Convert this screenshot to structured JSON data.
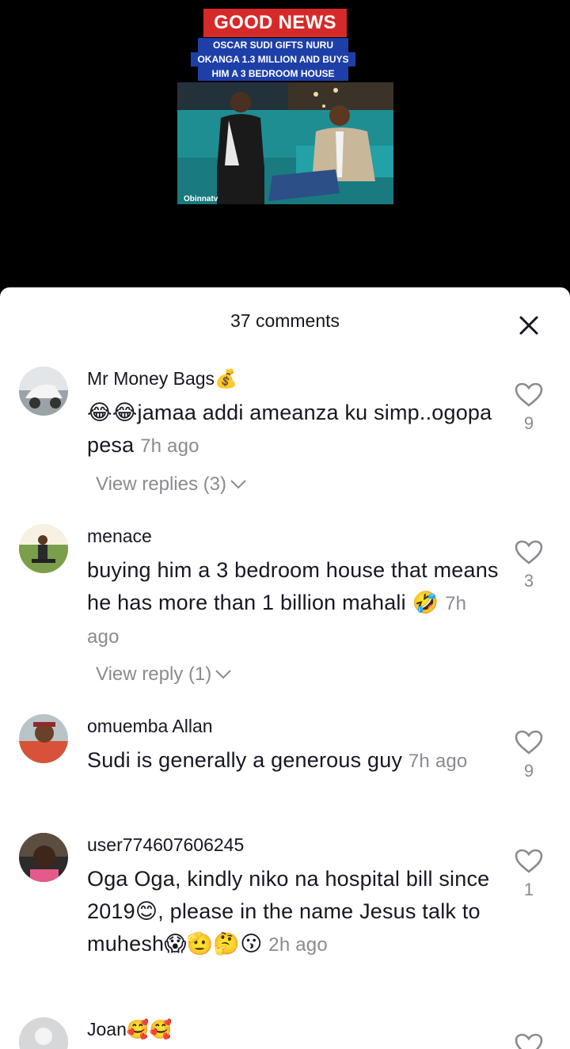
{
  "video": {
    "headline": "GOOD NEWS",
    "sub_lines": [
      "OSCAR SUDI GIFTS NURU",
      "OKANGA 1.3 MILLION AND BUYS",
      "HIM A 3 BEDROOM HOUSE"
    ],
    "watermark": "Obinnatv"
  },
  "sheet": {
    "title": "37 comments"
  },
  "comments": [
    {
      "username": "Mr Money Bags💰",
      "text": "😂😂jamaa addi ameanza ku simp..ogopa pesa",
      "time": "7h ago",
      "likes": "9",
      "replies": "View replies (3)"
    },
    {
      "username": "menace",
      "text": "buying him a 3 bedroom house that means he has more than 1 billion mahali 🤣",
      "time": "7h ago",
      "likes": "3",
      "replies": "View reply (1)"
    },
    {
      "username": "omuemba Allan",
      "text": "Sudi is generally a generous guy",
      "time": "7h ago",
      "likes": "9"
    },
    {
      "username": "user774607606245",
      "text": "Oga Oga, kindly niko na hospital bill since 2019😊, please in the name Jesus talk to muhesh😱🫡🤔😗",
      "time": "2h ago",
      "likes": "1"
    },
    {
      "username": "Joan🥰🥰"
    }
  ],
  "colors": {
    "headline_red": "#d62a2a",
    "headline_blue": "#1f3fa8",
    "text_primary": "#161823",
    "text_secondary": "#8a8b91"
  }
}
